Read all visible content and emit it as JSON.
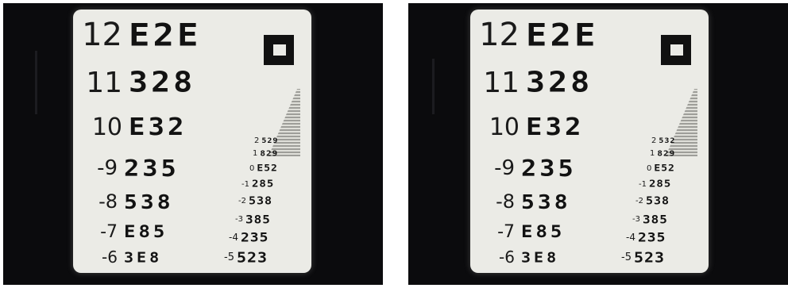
{
  "panels": [
    {
      "rows": [
        {
          "num": "12",
          "glyphs": "E2E"
        },
        {
          "num": "11",
          "glyphs": "328"
        },
        {
          "num": "10",
          "glyphs": "E32"
        },
        {
          "num": "-9",
          "glyphs": "235"
        },
        {
          "num": "-8",
          "glyphs": "538"
        },
        {
          "num": "-7",
          "glyphs": "E85"
        },
        {
          "num": "-6",
          "glyphs": "3E8"
        }
      ],
      "small_rows": [
        {
          "num": "2",
          "glyphs": "529"
        },
        {
          "num": "1",
          "glyphs": "829"
        },
        {
          "num": "0",
          "glyphs": "E52"
        },
        {
          "num": "-1",
          "glyphs": "285"
        },
        {
          "num": "-2",
          "glyphs": "538"
        },
        {
          "num": "-3",
          "glyphs": "385"
        },
        {
          "num": "-4",
          "glyphs": "235"
        },
        {
          "num": "-5",
          "glyphs": "523"
        }
      ]
    },
    {
      "rows": [
        {
          "num": "12",
          "glyphs": "E2E"
        },
        {
          "num": "11",
          "glyphs": "328"
        },
        {
          "num": "10",
          "glyphs": "E32"
        },
        {
          "num": "-9",
          "glyphs": "235"
        },
        {
          "num": "-8",
          "glyphs": "538"
        },
        {
          "num": "-7",
          "glyphs": "E85"
        },
        {
          "num": "-6",
          "glyphs": "3E8"
        }
      ],
      "small_rows": [
        {
          "num": "2",
          "glyphs": "532"
        },
        {
          "num": "1",
          "glyphs": "829"
        },
        {
          "num": "0",
          "glyphs": "E52"
        },
        {
          "num": "-1",
          "glyphs": "285"
        },
        {
          "num": "-2",
          "glyphs": "538"
        },
        {
          "num": "-3",
          "glyphs": "385"
        },
        {
          "num": "-4",
          "glyphs": "235"
        },
        {
          "num": "-5",
          "glyphs": "523"
        }
      ]
    }
  ]
}
